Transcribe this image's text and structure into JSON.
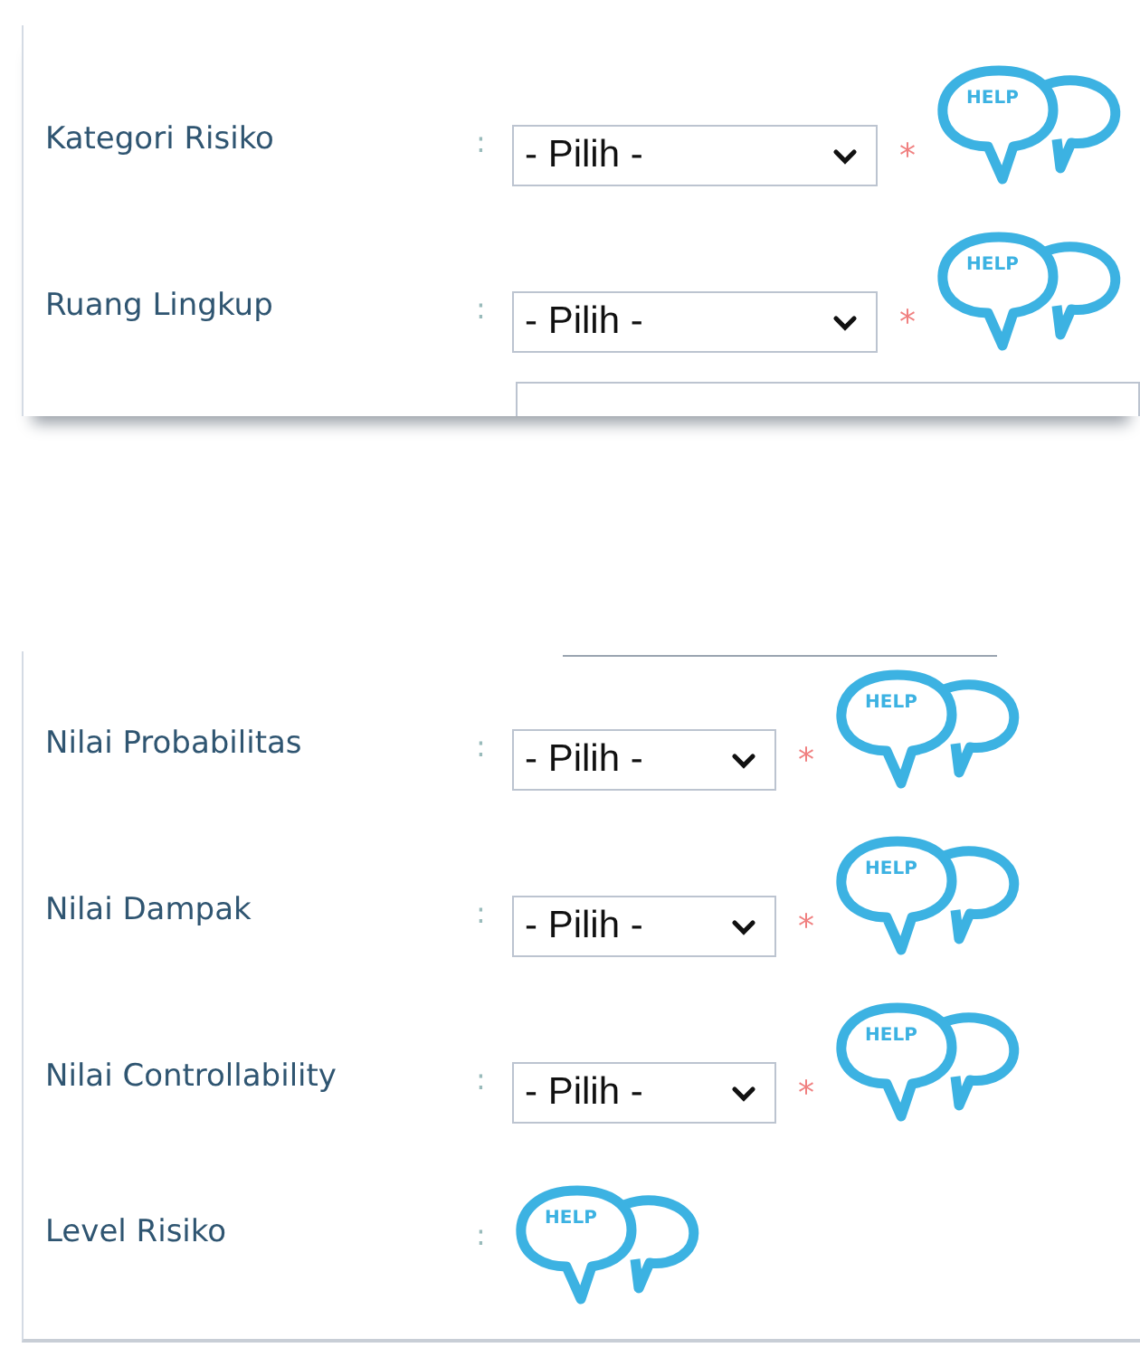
{
  "panels": [
    {
      "rows": [
        {
          "kind": "select",
          "label": "Kategori Risiko",
          "separator": ":",
          "value": "- Pilih -",
          "required_mark": "*",
          "help": "HELP"
        },
        {
          "kind": "select",
          "label": "Ruang Lingkup",
          "separator": ":",
          "value": "- Pilih -",
          "required_mark": "*",
          "help": "HELP"
        }
      ],
      "cut_field": true
    },
    {
      "rows": [
        {
          "kind": "select",
          "label": "Nilai Probabilitas",
          "separator": ":",
          "value": "- Pilih -",
          "required_mark": "*",
          "help": "HELP"
        },
        {
          "kind": "select",
          "label": "Nilai Dampak",
          "separator": ":",
          "value": "- Pilih -",
          "required_mark": "*",
          "help": "HELP"
        },
        {
          "kind": "select",
          "label": "Nilai Controllability",
          "separator": ":",
          "value": "- Pilih -",
          "required_mark": "*",
          "help": "HELP"
        },
        {
          "kind": "display",
          "label": "Level Risiko",
          "separator": ":",
          "help": "HELP"
        }
      ],
      "cut_field": false
    }
  ]
}
